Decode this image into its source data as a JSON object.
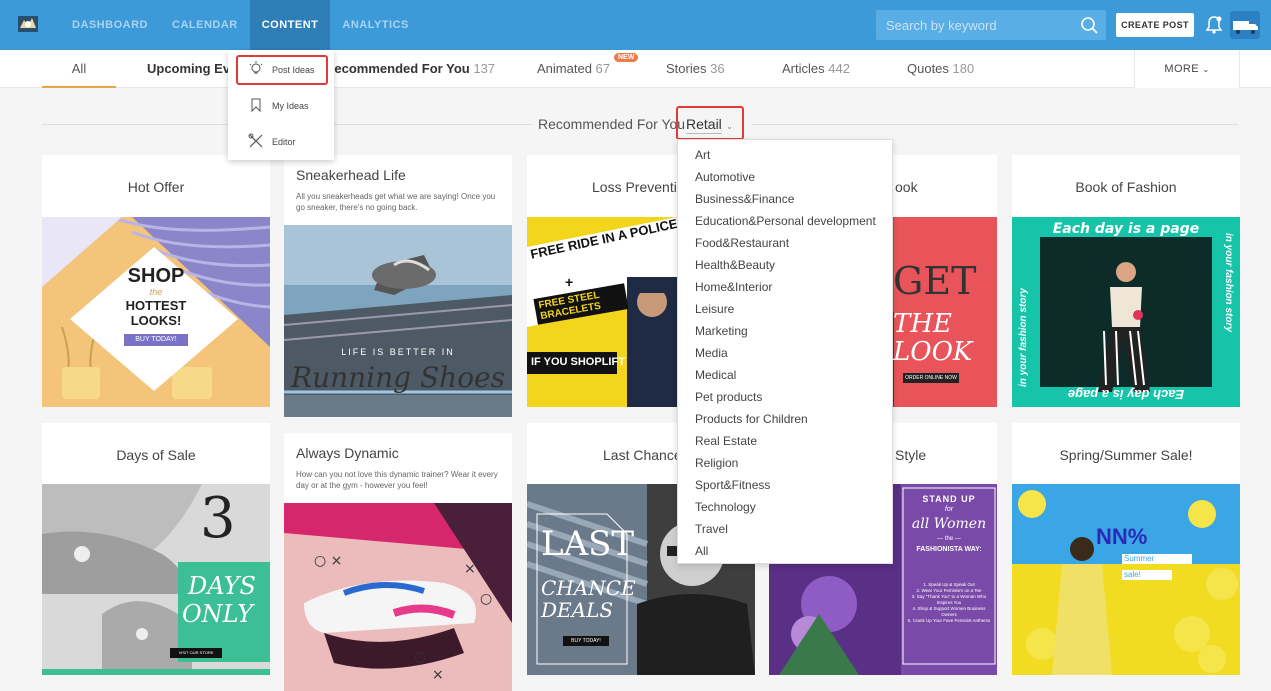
{
  "nav": {
    "links": [
      "DASHBOARD",
      "CALENDAR",
      "CONTENT",
      "ANALYTICS"
    ],
    "search_placeholder": "Search by keyword",
    "create_post": "CREATE POST"
  },
  "tabs": {
    "all": "All",
    "upcoming": "Upcoming Ever",
    "recommended": "Recommended For You",
    "recommended_count": "137",
    "animated": "Animated",
    "animated_count": "67",
    "new_badge": "NEW",
    "stories": "Stories",
    "stories_count": "36",
    "articles": "Articles",
    "articles_count": "442",
    "quotes": "Quotes",
    "quotes_count": "180",
    "more": "MORE"
  },
  "content_menu": {
    "post_ideas": "Post Ideas",
    "my_ideas": "My Ideas",
    "editor": "Editor"
  },
  "recommended": {
    "label": "Recommended For You",
    "selected": "Retail"
  },
  "industry_options": [
    "Art",
    "Automotive",
    "Business&Finance",
    "Education&Personal development",
    "Food&Restaurant",
    "Health&Beauty",
    "Home&Interior",
    "Leisure",
    "Marketing",
    "Media",
    "Medical",
    "Pet products",
    "Products for Children",
    "Real Estate",
    "Religion",
    "Sport&Fitness",
    "Technology",
    "Travel",
    "All"
  ],
  "cards": {
    "hot_offer": {
      "title": "Hot Offer",
      "shop": "SHOP",
      "the": "the",
      "hottest": "HOTTEST",
      "looks": "LOOKS!",
      "buy": "BUY TODAY!"
    },
    "sneakerhead": {
      "title": "Sneakerhead Life",
      "desc": "All you sneakerheads get what we are saying! Once you go sneaker, there's no going back.",
      "life": "LIFE IS BETTER IN",
      "running": "Running Shoes"
    },
    "loss": {
      "title": "Loss Preventio",
      "free_ride": "FREE RIDE IN A POLICE C",
      "plus": "+",
      "free_steel": "FREE STEEL BRACELETS",
      "shoplift": "IF YOU SHOPLIFT"
    },
    "look": {
      "title": "ook",
      "get": "GET",
      "the": "THE",
      "look": "LOOK",
      "order": "ORDER ONLINE NOW"
    },
    "fashion": {
      "title": "Book of Fashion",
      "top": "Each day is a page",
      "left": "in your fashion story",
      "right": "in your fashion story",
      "bottom": "Each day is a page"
    },
    "days": {
      "title": "Days of Sale",
      "num": "3",
      "days": "DAYS",
      "only": "ONLY",
      "visit": "VISIT OUR STORE"
    },
    "dynamic": {
      "title": "Always Dynamic",
      "desc": "How can you not love this dynamic trainer? Wear it every day or at the gym - however you feel!"
    },
    "last": {
      "title": "Last Chance",
      "last": "LAST",
      "chance": "CHANCE",
      "deals": "DEALS",
      "buy": "BUY TODAY!"
    },
    "style": {
      "title": "Style",
      "stand": "STAND UP",
      "for": "for",
      "women": "all Women",
      "the": "— the —",
      "fashionista": "FASHIONISTA WAY:",
      "list": [
        "1. Speak Up & Speak Out",
        "2. Wear Your Feminism on a Tee",
        "3. Say \"Thank You\" to a Woman Who Inspires You",
        "4. Shop & Support Women Business Owners",
        "5. Crank Up Your Fave Feminist Anthems"
      ]
    },
    "spring": {
      "title": "Spring/Summer Sale!",
      "nn": "NN%",
      "summer": "Summer",
      "sale": "sale!"
    }
  }
}
